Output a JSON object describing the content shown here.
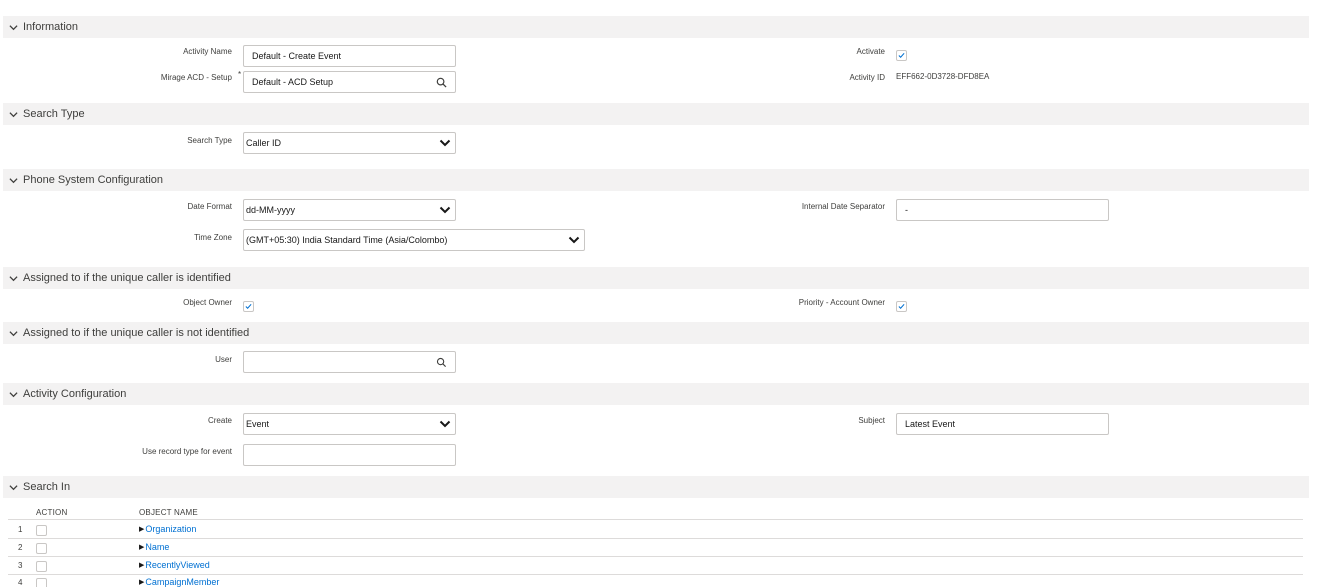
{
  "sections": {
    "information": "Information",
    "search_type": "Search Type",
    "phone_system": "Phone System Configuration",
    "assigned_identified": "Assigned to if the unique caller is identified",
    "assigned_not_identified": "Assigned to if the unique caller is not identified",
    "activity_config": "Activity Configuration",
    "search_in": "Search In"
  },
  "information": {
    "activity_name_label": "Activity Name",
    "activity_name_value": "Default - Create Event",
    "mirage_label": "Mirage ACD - Setup",
    "mirage_required": "*",
    "mirage_value": "Default - ACD Setup",
    "activate_label": "Activate",
    "activate_checked": true,
    "activity_id_label": "Activity ID",
    "activity_id_value": "EFF662-0D3728-DFD8EA"
  },
  "search_type": {
    "label": "Search Type",
    "value": "Caller ID"
  },
  "phone_system": {
    "date_format_label": "Date Format",
    "date_format_value": "dd-MM-yyyy",
    "separator_label": "Internal Date Separator",
    "separator_value": "-",
    "time_zone_label": "Time Zone",
    "time_zone_value": "(GMT+05:30) India Standard Time (Asia/Colombo)"
  },
  "assigned_identified": {
    "object_owner_label": "Object Owner",
    "object_owner_checked": true,
    "priority_label": "Priority - Account Owner",
    "priority_checked": true
  },
  "assigned_not_identified": {
    "user_label": "User",
    "user_value": ""
  },
  "activity_config": {
    "create_label": "Create",
    "create_value": "Event",
    "subject_label": "Subject",
    "subject_value": "Latest Event",
    "record_type_label": "Use record type for event",
    "record_type_value": ""
  },
  "search_in": {
    "columns": [
      "ACTION",
      "OBJECT NAME"
    ],
    "rows": [
      {
        "num": "1",
        "name": "Organization"
      },
      {
        "num": "2",
        "name": "Name"
      },
      {
        "num": "3",
        "name": "RecentlyViewed"
      },
      {
        "num": "4",
        "name": "CampaignMember"
      }
    ]
  },
  "icons": {
    "section_toggle": "chevron-down-icon",
    "lookup": "search-icon",
    "select": "caret-down-icon",
    "check": "checkmark-icon",
    "expand": "triangle-right-icon"
  }
}
